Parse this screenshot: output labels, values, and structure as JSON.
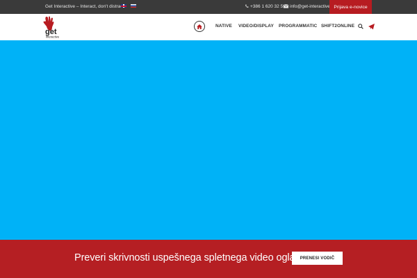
{
  "topbar": {
    "tagline": "Get Interactive – Interact, don't distract.",
    "languages": [
      {
        "code": "en",
        "icon": "flag-uk-icon"
      },
      {
        "code": "sl",
        "icon": "flag-slovenia-icon"
      }
    ],
    "phone": "+386 1 620 32 55",
    "email": "info@get-interactive.eu",
    "newsletter_label": "Prijava e-novice"
  },
  "logo": {
    "text_main": "get",
    "text_sub": "interactive"
  },
  "nav": {
    "items": [
      "NATIVE",
      "VIDEO/DISPLAY",
      "PROGRAMMATIC",
      "SHIFT2ONLINE"
    ]
  },
  "banner": {
    "text": "Preveri skrivnosti uspešnega spletnega video oglaševanja",
    "button_label": "PRENESI VODIČ"
  },
  "colors": {
    "topbar_bg": "#3a3a3a",
    "accent_red": "#b71c21",
    "hero_blue": "#00b2f7"
  }
}
